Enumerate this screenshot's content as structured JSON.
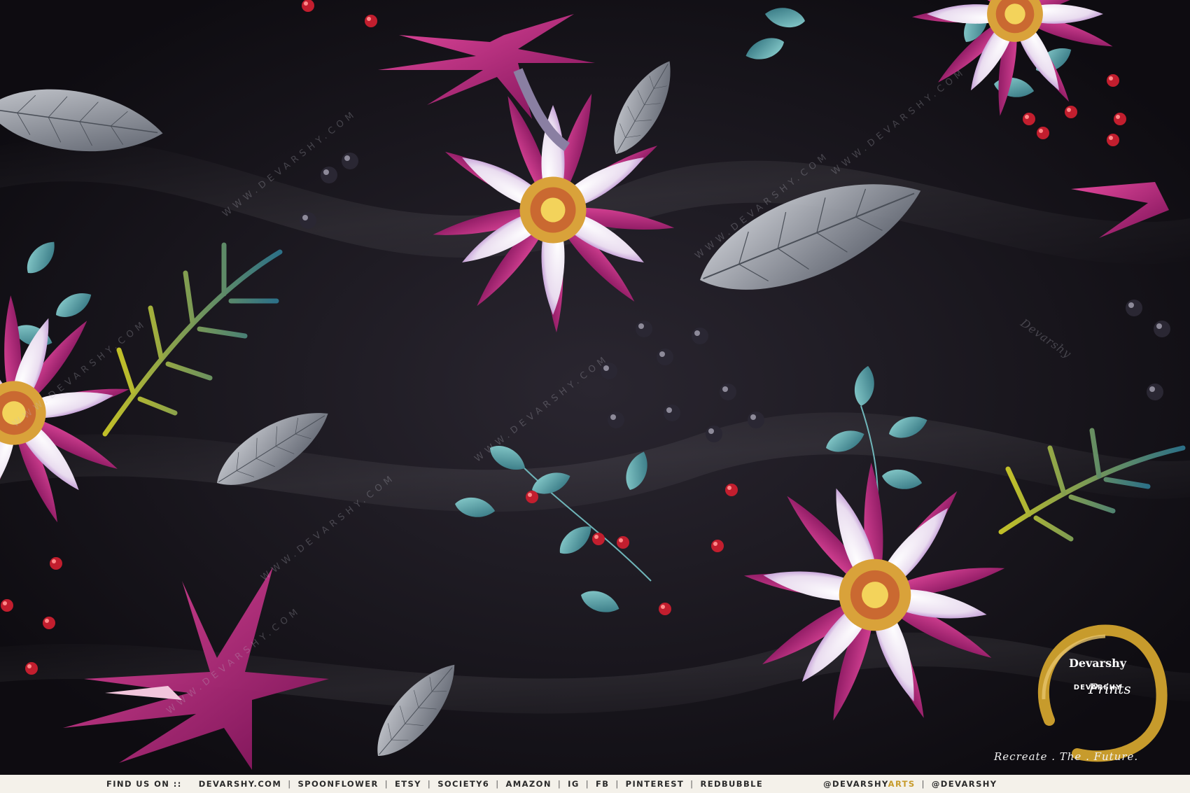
{
  "image": {
    "subject": "floral-print-fabric",
    "colors": {
      "background": "#141217",
      "petal_white": "#f4eef6",
      "petal_magenta": "#b0176d",
      "petal_purple": "#7a3fa5",
      "leaf_teal": "#4fa1a8",
      "leaf_grey": "#8a8f98",
      "fern_yellow": "#c8c72a",
      "berry_red": "#c21e2e",
      "logo_gold": "#c79b2c"
    }
  },
  "watermarks": {
    "text": "WWW.DEVARSHY.COM",
    "signature": "Devarshy"
  },
  "logo": {
    "brand": "Devarshy",
    "subtitle": "DEVARSHY",
    "prints": "Prints",
    "tagline": "Recreate . The . Future."
  },
  "footer": {
    "label": "FIND US ON ::",
    "links": [
      "DEVARSHY.COM",
      "SPOONFLOWER",
      "ETSY",
      "SOCIETY6",
      "AMAZON",
      "IG",
      "FB",
      "PINTEREST",
      "REDBUBBLE"
    ],
    "handle_arts_prefix": "@DEVARSHY",
    "handle_arts_suffix": "ARTS",
    "handle": "@DEVARSHY",
    "separator": "|"
  }
}
